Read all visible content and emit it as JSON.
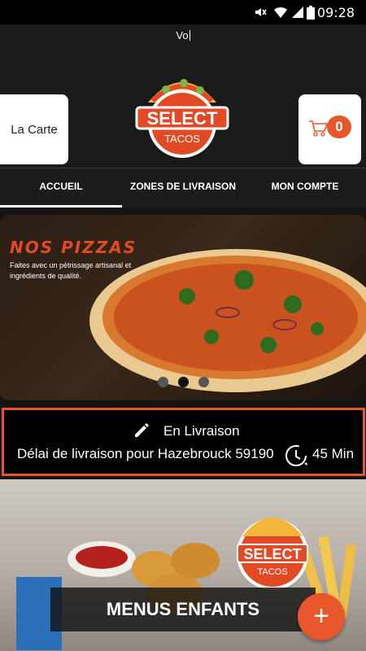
{
  "status_bar": {
    "time": "09:28"
  },
  "header": {
    "typed_text": "Vo",
    "la_carte_label": "La Carte",
    "cart_count": "0",
    "logo": {
      "brand": "SELECT",
      "sub": "TACOS"
    }
  },
  "nav": {
    "tabs": [
      {
        "label": "ACCUEIL",
        "active": true
      },
      {
        "label": "ZONES DE LIVRAISON",
        "active": false
      },
      {
        "label": "MON COMPTE",
        "active": false
      }
    ]
  },
  "banner": {
    "title": "NOS PIZZAS",
    "subtitle": "Faites avec un pétrissage artisanal et ingrédients de qualité.",
    "active_slide": 2,
    "slide_count": 3
  },
  "delivery": {
    "mode": "En Livraison",
    "delay_text": "Délai de livraison pour Hazebrouck 59190",
    "minutes": "45 Min"
  },
  "promo": {
    "label": "MENUS ENFANTS",
    "logo": {
      "brand": "SELECT",
      "sub": "TACOS"
    }
  },
  "colors": {
    "accent": "#e8562b",
    "background": "#141414"
  },
  "icons": [
    "mute-icon",
    "wifi-icon",
    "signal-icon",
    "battery-icon",
    "cart-icon",
    "pencil-icon",
    "clock-icon",
    "plus-icon"
  ]
}
